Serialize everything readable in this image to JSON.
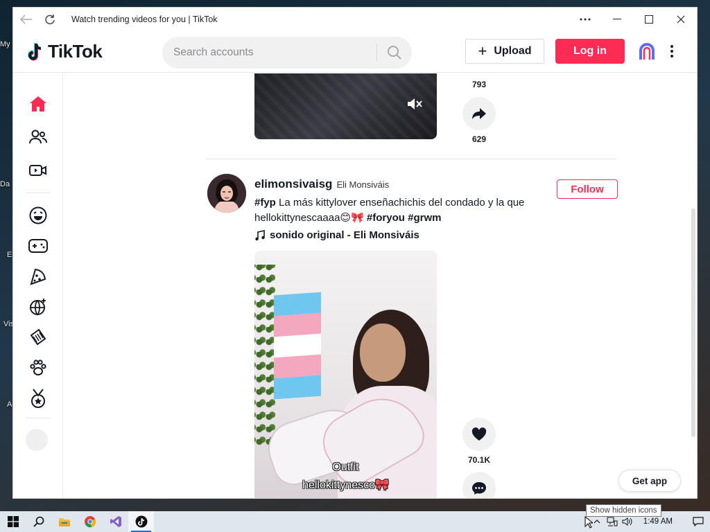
{
  "window": {
    "title": "Watch trending videos for you | TikTok"
  },
  "desktop": {
    "labels": [
      "My",
      "Da",
      "E",
      "Vis",
      "A"
    ]
  },
  "header": {
    "logo_text": "TikTok",
    "search_placeholder": "Search accounts",
    "upload_label": "Upload",
    "login_label": "Log in"
  },
  "sidebar": {
    "items": [
      "home-icon",
      "following-icon",
      "live-icon",
      "comedy-icon",
      "gaming-icon",
      "food-icon",
      "sports-icon",
      "beauty-icon",
      "animals-icon",
      "achievement-icon"
    ]
  },
  "prev_post": {
    "count_top": "793",
    "share_count": "629"
  },
  "post": {
    "author_id": "elimonsivaisg",
    "author_name": "Eli Monsiváis",
    "follow_label": "Follow",
    "desc_tag1": "#fyp",
    "desc_text": " La más kittylover enseñachichis del condado y la que hellokittynescaaaa",
    "desc_emoji": "😊🎀",
    "desc_tag2": "#foryou",
    "desc_tag3": "#grwm",
    "music": "sonido original - Eli Monsiváis",
    "caption_line1": "Outfit",
    "caption_line2": "hellokittynesco🎀",
    "like_count": "70.1K"
  },
  "get_app_label": "Get app",
  "taskbar": {
    "clock": "1:49 AM",
    "tooltip": "Show hidden icons"
  },
  "colors": {
    "brand": "#fe2c55",
    "text": "#161823"
  }
}
